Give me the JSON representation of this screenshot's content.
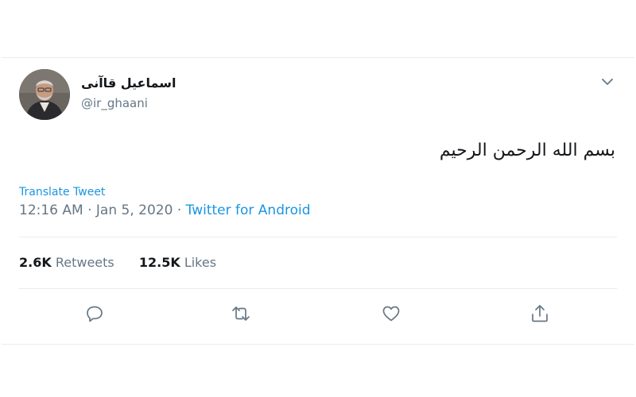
{
  "tweet": {
    "author": {
      "display_name": "اسماعیل قاآنی",
      "handle": "@ir_ghaani"
    },
    "text": "بسم الله الرحمن الرحيم",
    "translate_label": "Translate Tweet",
    "time": "12:16 AM",
    "separator": "·",
    "date": "Jan 5, 2020",
    "source": "Twitter for Android",
    "stats": {
      "retweets_count": "2.6K",
      "retweets_label": "Retweets",
      "likes_count": "12.5K",
      "likes_label": "Likes"
    },
    "icons": {
      "menu": "chevron-down-icon",
      "reply": "reply-icon",
      "retweet": "retweet-icon",
      "like": "heart-icon",
      "share": "share-icon"
    }
  },
  "colors": {
    "link": "#1b95e0",
    "secondary_text": "#657786",
    "border": "#e6ecf0",
    "icon": "#657786"
  }
}
